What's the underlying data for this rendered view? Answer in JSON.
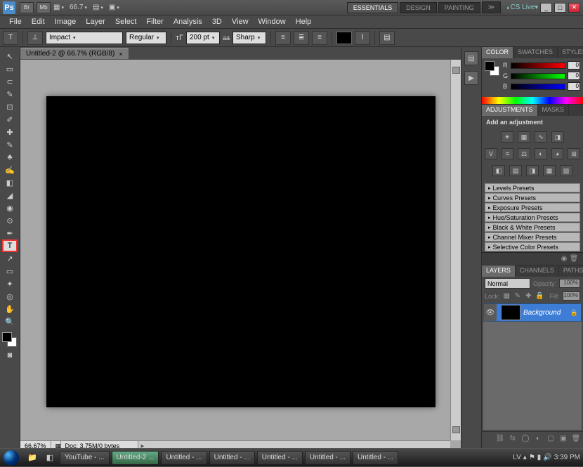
{
  "app": {
    "logo": "Ps"
  },
  "topbar": {
    "zoom": "66.7",
    "workspaces": [
      "ESSENTIALS",
      "DESIGN",
      "PAINTING"
    ],
    "cslive": "CS Live"
  },
  "menu": [
    "File",
    "Edit",
    "Image",
    "Layer",
    "Select",
    "Filter",
    "Analysis",
    "3D",
    "View",
    "Window",
    "Help"
  ],
  "options": {
    "font": "Impact",
    "weight": "Regular",
    "size": "200 pt",
    "aa_label": "aa",
    "aa": "Sharp"
  },
  "doc": {
    "tab": "Untitled-2 @ 66.7% (RGB/8)",
    "zoom": "66.67%",
    "info": "Doc: 3.75M/0 bytes"
  },
  "panels": {
    "color": {
      "tabs": [
        "COLOR",
        "SWATCHES",
        "STYLES"
      ],
      "r": "0",
      "g": "0",
      "b": "0",
      "r_label": "R",
      "g_label": "G",
      "b_label": "B"
    },
    "adjustments": {
      "tabs": [
        "ADJUSTMENTS",
        "MASKS"
      ],
      "title": "Add an adjustment",
      "presets": [
        "Levels Presets",
        "Curves Presets",
        "Exposure Presets",
        "Hue/Saturation Presets",
        "Black & White Presets",
        "Channel Mixer Presets",
        "Selective Color Presets"
      ]
    },
    "layers": {
      "tabs": [
        "LAYERS",
        "CHANNELS",
        "PATHS"
      ],
      "mode": "Normal",
      "opacity_label": "Opacity:",
      "opacity": "100%",
      "lock_label": "Lock:",
      "fill_label": "Fill:",
      "fill": "100%",
      "layer_name": "Background"
    }
  },
  "taskbar": {
    "tasks": [
      "YouTube - ...",
      "Untitled-2 ...",
      "Untitled - ...",
      "Untitled - ...",
      "Untitled - ...",
      "Untitled - ...",
      "Untitled - ..."
    ],
    "lang": "LV",
    "time": "3:39 PM"
  }
}
